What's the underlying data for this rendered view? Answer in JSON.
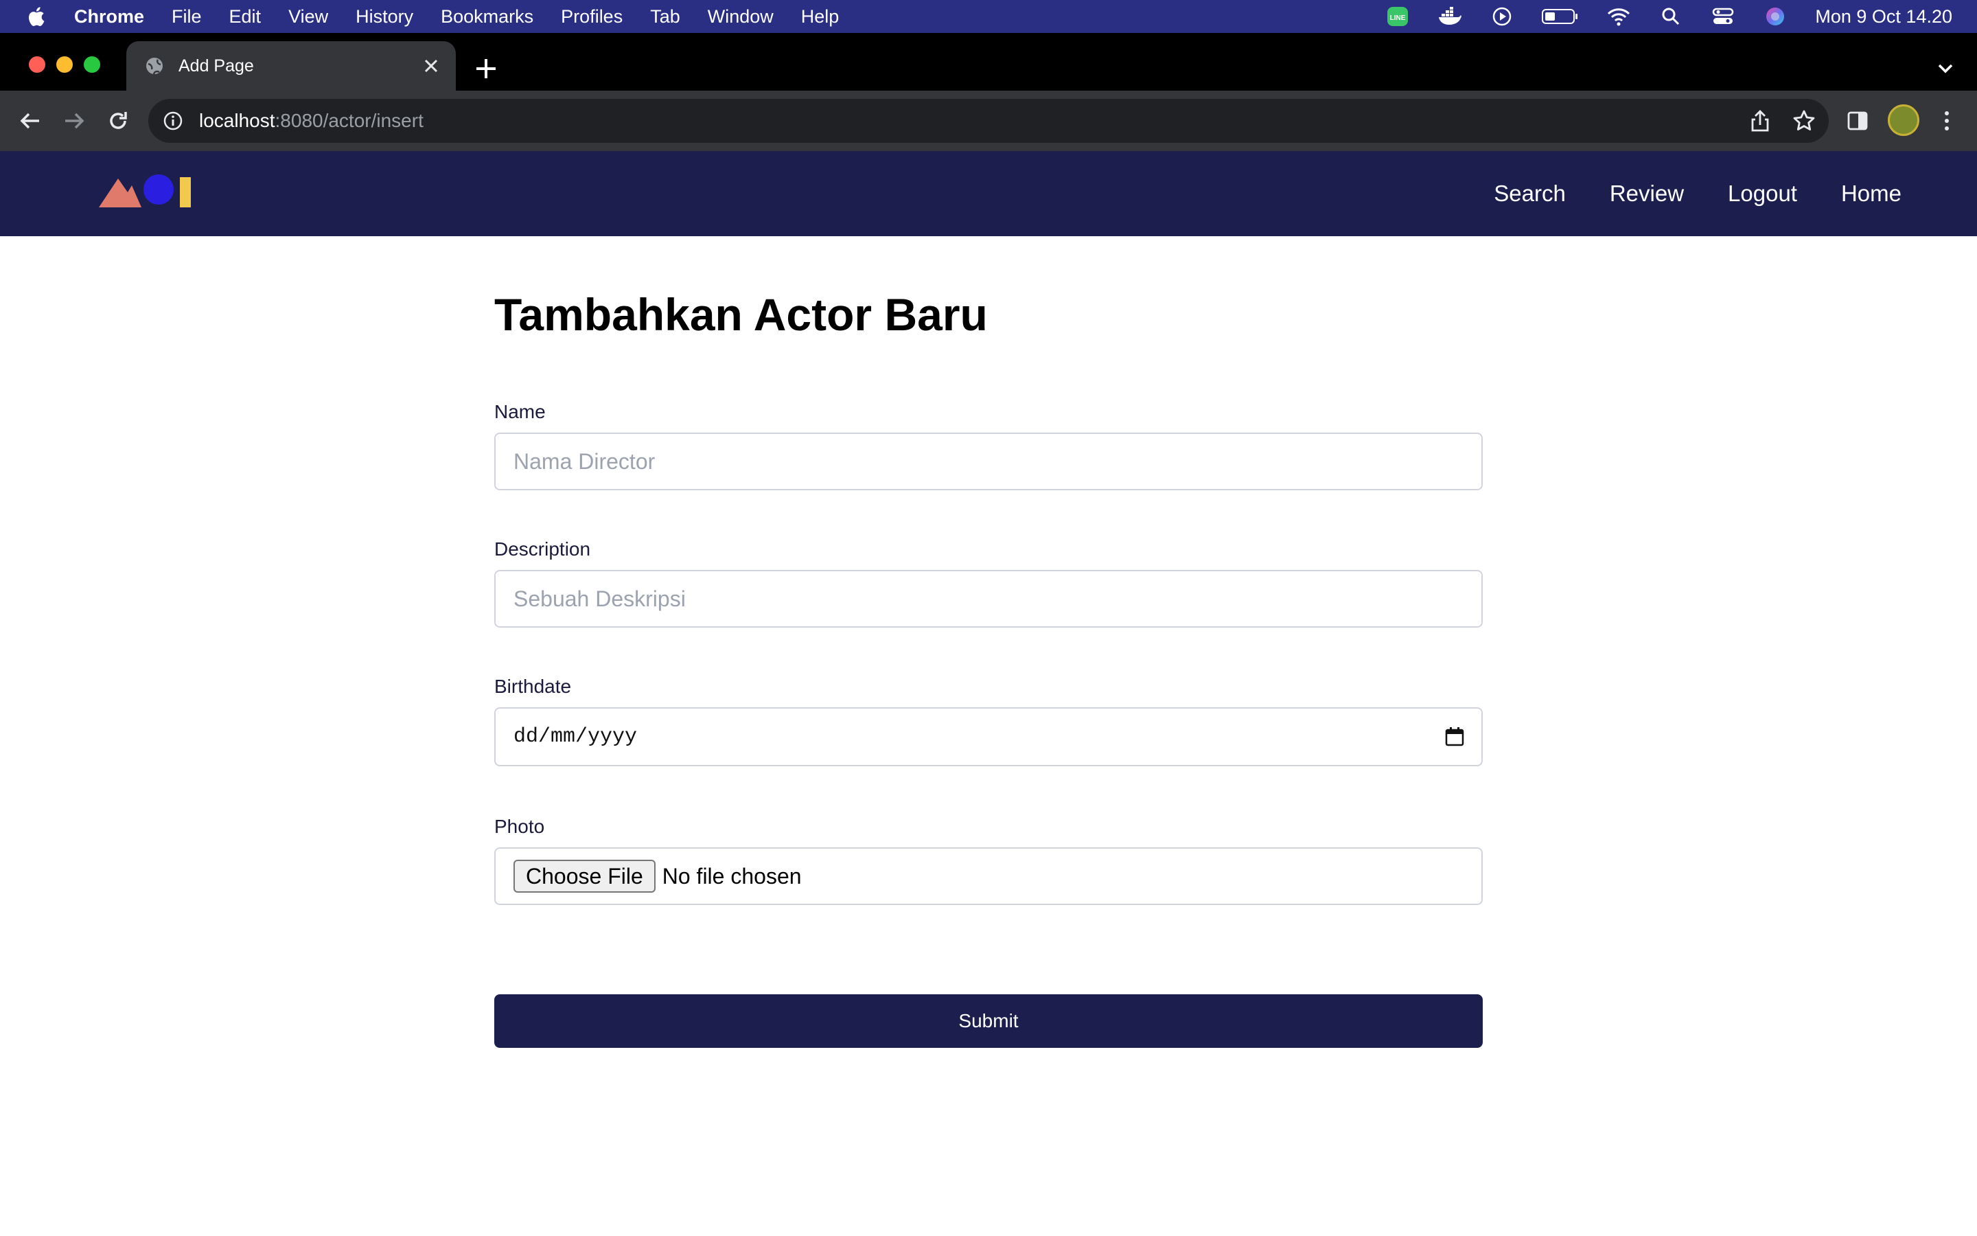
{
  "menubar": {
    "items": [
      "Chrome",
      "File",
      "Edit",
      "View",
      "History",
      "Bookmarks",
      "Profiles",
      "Tab",
      "Window",
      "Help"
    ],
    "status_icons": [
      "line-icon",
      "docker-icon",
      "play-icon",
      "battery-icon",
      "wifi-icon",
      "spotlight-search-icon",
      "control-center-icon",
      "siri-icon"
    ],
    "clock": "Mon 9 Oct  14.20"
  },
  "browser": {
    "tab_title": "Add Page",
    "url_host": "localhost",
    "url_rest": ":8080/actor/insert"
  },
  "site_nav": {
    "logo_colors": {
      "triangle": "#e07a6a",
      "circle": "#2a1fe0",
      "bar": "#f2c94c"
    },
    "links": [
      "Search",
      "Review",
      "Logout",
      "Home"
    ]
  },
  "form": {
    "title": "Tambahkan Actor Baru",
    "name_label": "Name",
    "name_placeholder": "Nama Director",
    "description_label": "Description",
    "description_placeholder": "Sebuah Deskripsi",
    "birthdate_label": "Birthdate",
    "birthdate_value": "dd/mm/yyyy",
    "photo_label": "Photo",
    "choose_file_label": "Choose File",
    "no_file_text": "No file chosen",
    "submit_label": "Submit"
  },
  "colors": {
    "menubar_bg": "#2b2f84",
    "navbar_bg": "#1c1f4e",
    "submit_bg": "#1c1f4e"
  }
}
